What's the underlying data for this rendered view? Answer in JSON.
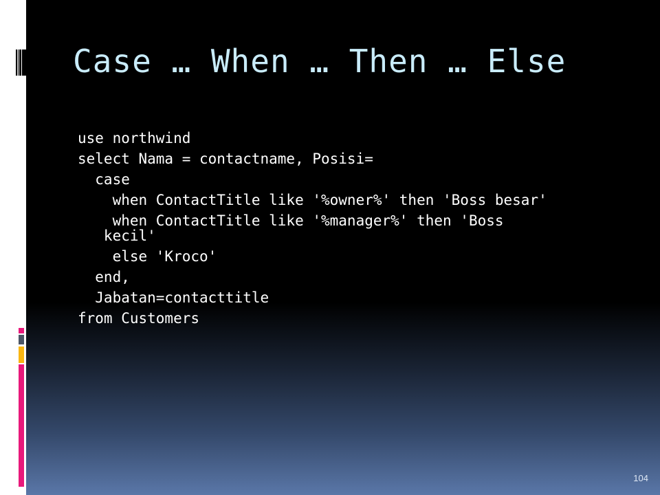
{
  "slide": {
    "title": "Case … When … Then … Else",
    "code_lines": [
      "use northwind",
      "select Nama = contactname, Posisi=",
      "  case",
      "    when ContactTitle like '%owner%' then 'Boss besar'",
      "    when ContactTitle like '%manager%' then 'Boss",
      "   kecil'",
      "    else 'Kroco'",
      "  end,",
      "  Jabatan=contacttitle",
      "from Customers"
    ],
    "slide_number": "104"
  },
  "decoration": {
    "accent_pink": "#e8197b",
    "accent_gray": "#4b5565",
    "accent_yellow": "#f9b612",
    "background_top": "#000000",
    "background_bottom": "#5a77a8",
    "title_color": "#c9ecfb"
  }
}
